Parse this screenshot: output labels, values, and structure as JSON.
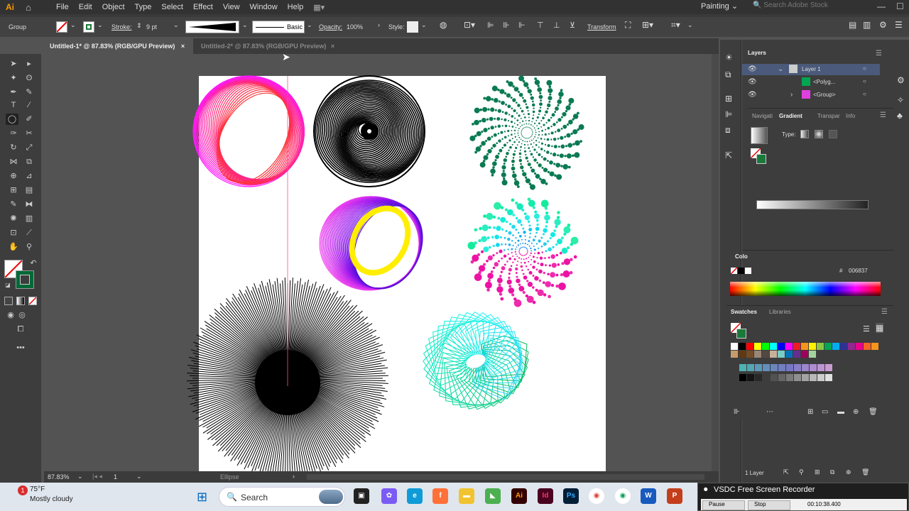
{
  "app": {
    "logo": "Ai",
    "menu": [
      "File",
      "Edit",
      "Object",
      "Type",
      "Select",
      "Effect",
      "View",
      "Window",
      "Help"
    ],
    "workspace": "Painting",
    "search_placeholder": "Search Adobe Stock"
  },
  "controlbar": {
    "selection_label": "Group",
    "stroke_label": "Stroke:",
    "stroke_value": "9 pt",
    "brush_label": "Basic",
    "opacity_label": "Opacity:",
    "opacity_value": "100%",
    "style_label": "Style:",
    "transform_label": "Transform"
  },
  "tabs": [
    {
      "label": "Untitled-1* @ 87.83% (RGB/GPU Preview)",
      "active": true
    },
    {
      "label": "Untitled-2* @ 87.83% (RGB/GPU Preview)",
      "active": false
    }
  ],
  "status": {
    "zoom": "87.83%",
    "artboard": "1",
    "tool": "Ellipse"
  },
  "layers": {
    "tab": "Layers",
    "items": [
      "Layer 1",
      "<Polyg...",
      "<Group>"
    ],
    "count": "1 Layer"
  },
  "gradient_panel": {
    "tabs": [
      "Navigati",
      "Gradient",
      "Transpar",
      "Info"
    ],
    "type_label": "Type:"
  },
  "color_panel": {
    "tab": "Colo",
    "hex_value": "006837"
  },
  "swatches": {
    "tabs": [
      "Swatches",
      "Libraries"
    ],
    "colors": [
      "#ffffff",
      "#000000",
      "#ff0000",
      "#ffff00",
      "#00ff00",
      "#00ffff",
      "#0000ff",
      "#ff00ff",
      "#ed1c24",
      "#f7941d",
      "#fff200",
      "#8dc63f",
      "#00a651",
      "#00aeef",
      "#2e3192",
      "#92278f",
      "#ec008c",
      "#f26522",
      "#f7941d",
      "#c69c6d",
      "#603913",
      "#754c24",
      "#998675",
      "#534741",
      "#c7b299",
      "#7accc8",
      "#0072bc",
      "#662d91",
      "#9e005d",
      "#a3d39c"
    ]
  },
  "taskbar": {
    "weather_temp": "75°F",
    "weather_desc": "Mostly cloudy",
    "badge": "1",
    "search": "Search",
    "recorder_title": "VSDC Free Screen Recorder",
    "recorder_pause": "Pause",
    "recorder_stop": "Stop",
    "recorder_time": "00:10:38.400"
  }
}
